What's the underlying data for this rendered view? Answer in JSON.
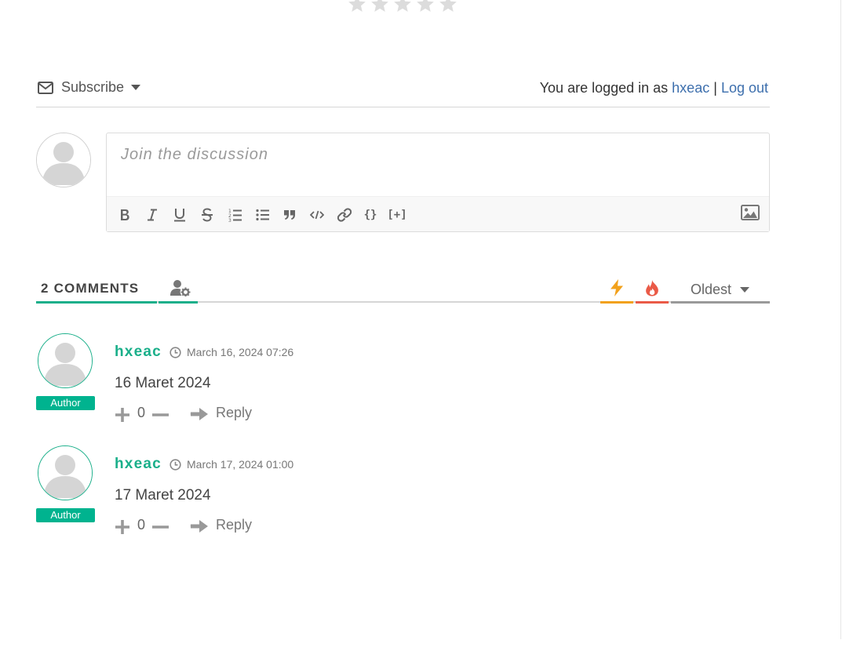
{
  "rating": {
    "stars": 5,
    "icon": "star-icon",
    "color": "#dcdcdc"
  },
  "subscribe": {
    "icon": "envelope-icon",
    "label": "Subscribe"
  },
  "login": {
    "prefix": "You are logged in as",
    "username": "hxeac",
    "separator": "|",
    "logout": "Log out"
  },
  "form": {
    "placeholder": "Join the discussion",
    "toolbar": [
      "bold",
      "italic",
      "underline",
      "strikethrough",
      "ordered-list",
      "unordered-list",
      "blockquote",
      "code",
      "link",
      "source-code",
      "spoiler",
      "image"
    ],
    "curly_label": "{}",
    "spoiler_label": "[+]"
  },
  "comments_header": {
    "count_label": "2 COMMENTS",
    "sort_selected": "Oldest",
    "colors": {
      "accent": "#1aaf8a",
      "newest": "#f2a11b",
      "hottest": "#ea5a47"
    }
  },
  "comments": [
    {
      "author": "hxeac",
      "badge": "Author",
      "date": "March 16, 2024 07:26",
      "text": "16 Maret 2024",
      "score": "0",
      "reply": "Reply"
    },
    {
      "author": "hxeac",
      "badge": "Author",
      "date": "March 17, 2024 01:00",
      "text": "17 Maret 2024",
      "score": "0",
      "reply": "Reply"
    }
  ]
}
